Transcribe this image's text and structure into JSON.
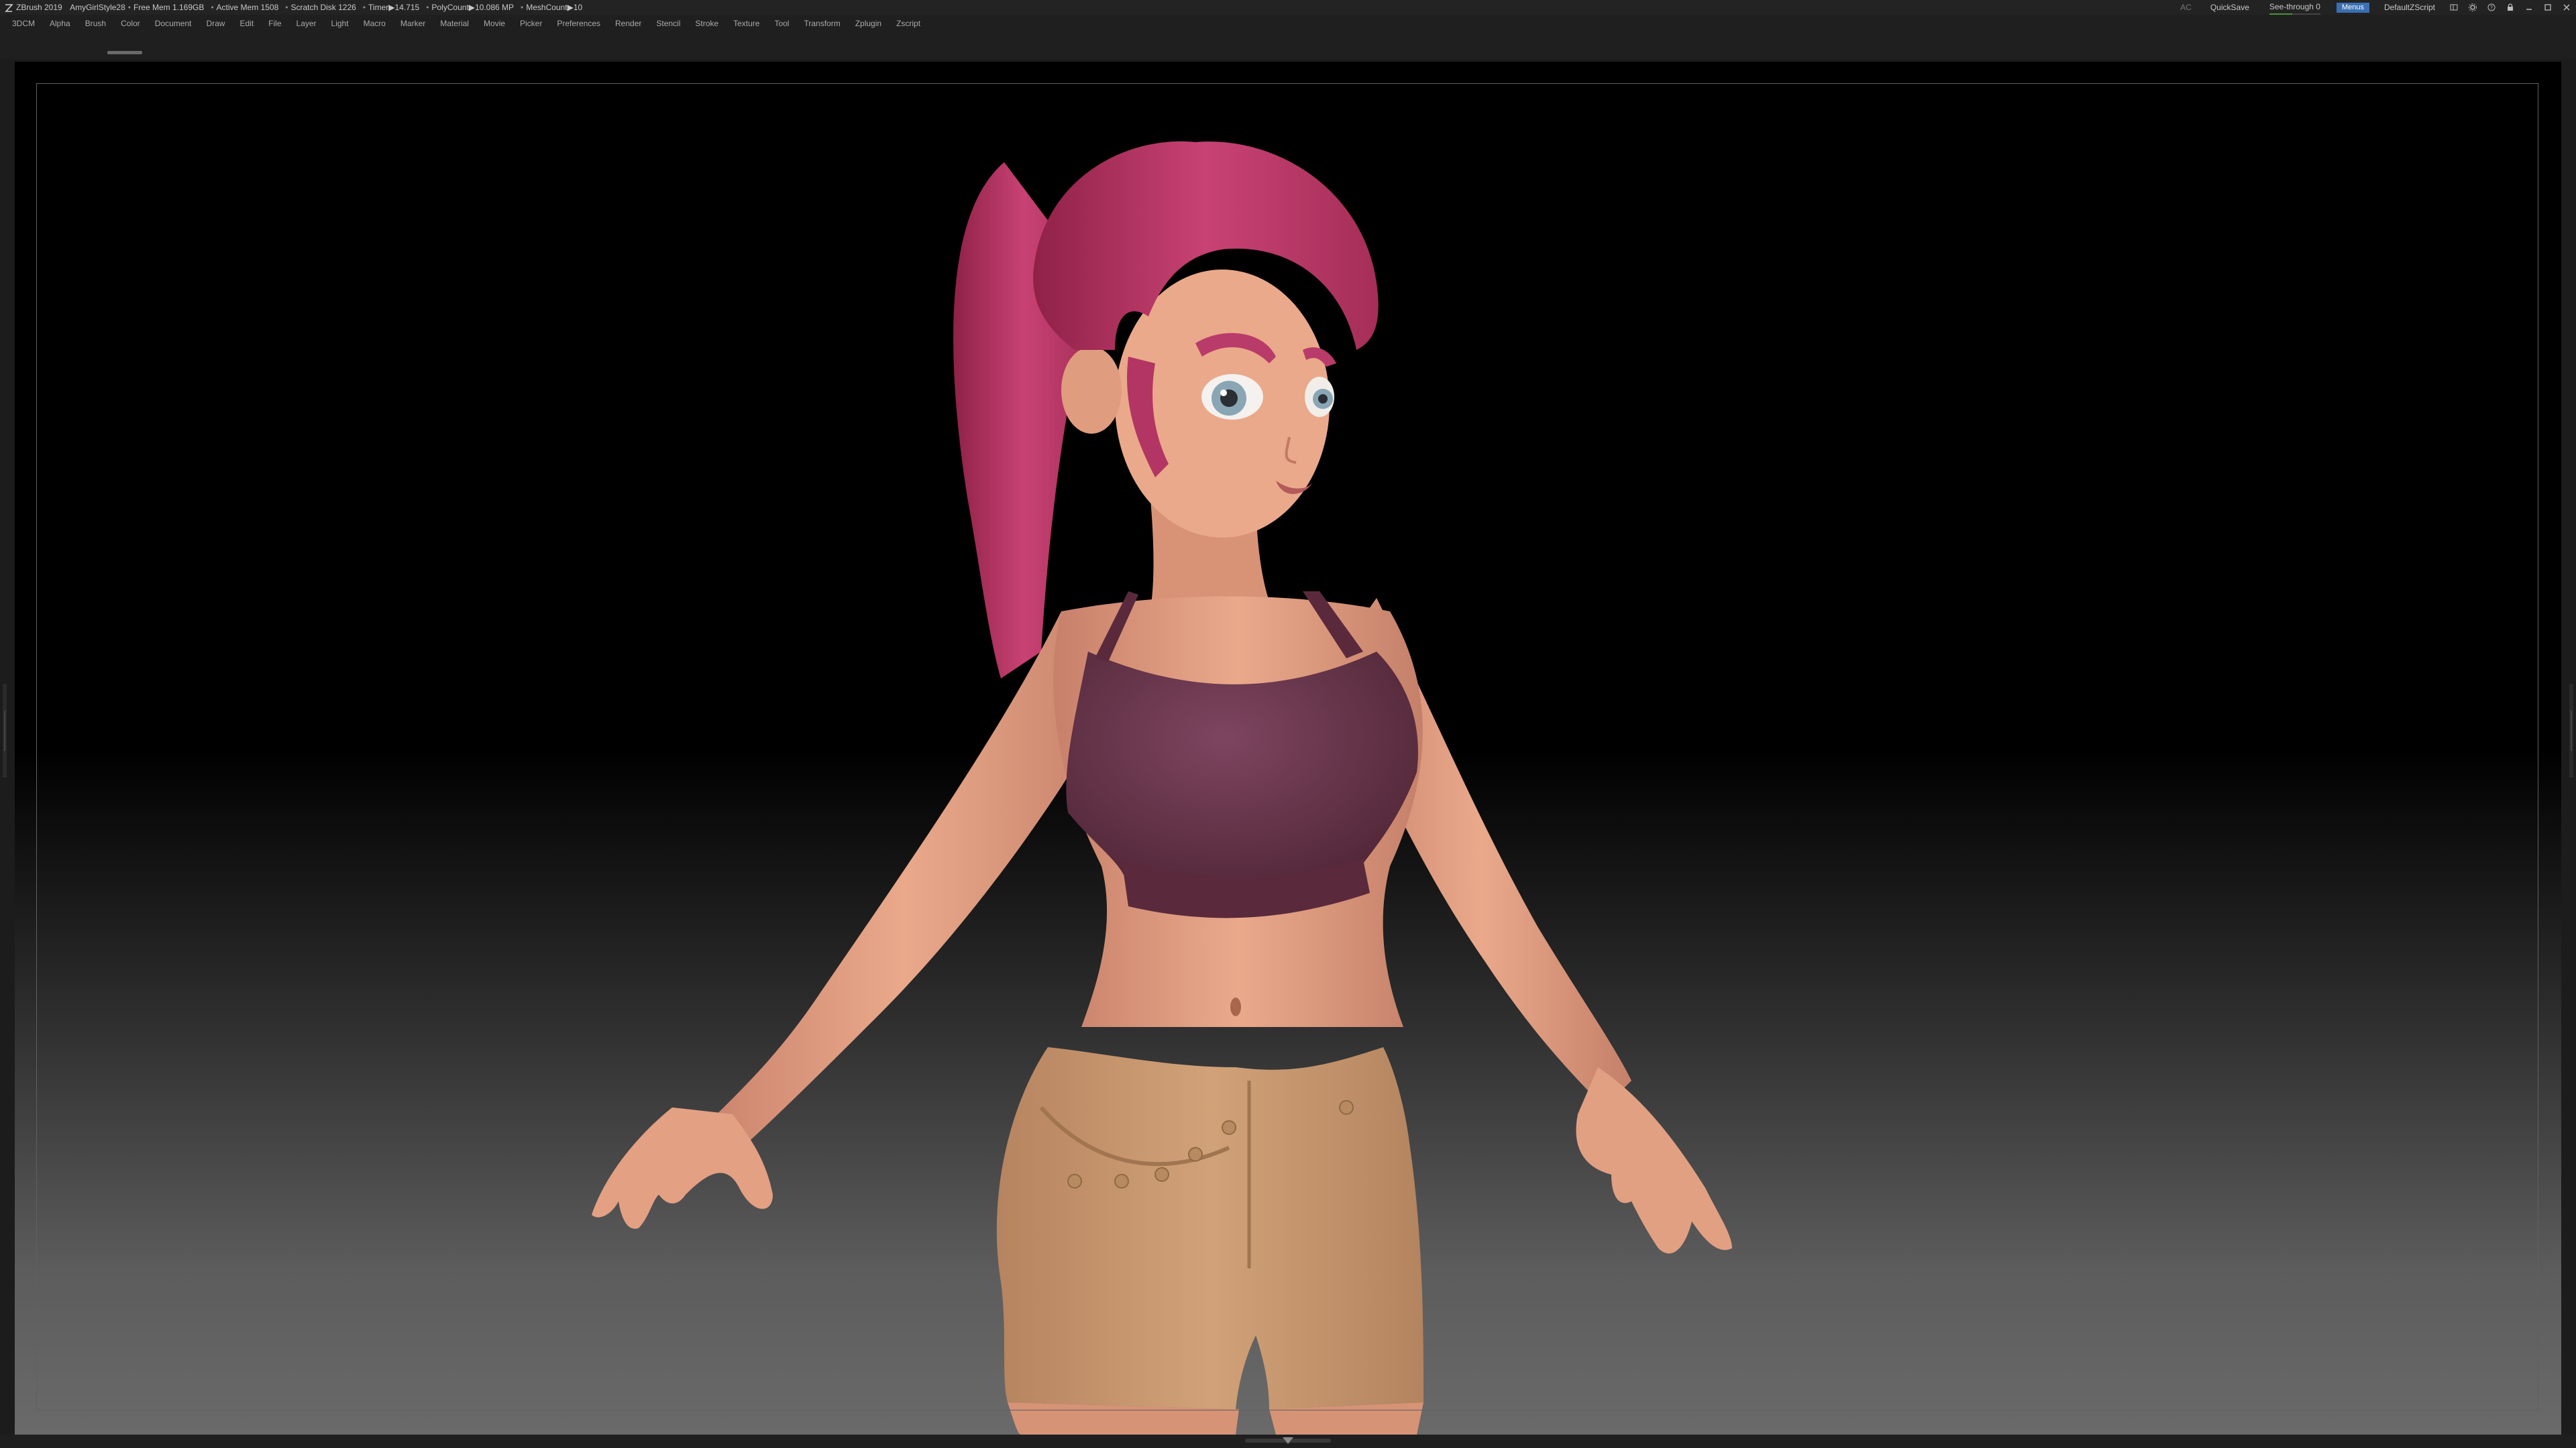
{
  "titlebar": {
    "app": "ZBrush 2019",
    "project": "AmyGirlStyle28",
    "free_mem": "Free Mem 1.169GB",
    "active_mem": "Active Mem 1508",
    "scratch_disk": "Scratch Disk 1226",
    "timer": "Timer▶14.715",
    "poly_count": "PolyCount▶10.086 MP",
    "mesh_count": "MeshCount▶10",
    "ac_label": "AC",
    "quicksave_label": "QuickSave",
    "see_through_label": "See-through 0",
    "see_through_value": 0,
    "menus_label": "Menus",
    "script_label": "DefaultZScript"
  },
  "menus": [
    "3DCM",
    "Alpha",
    "Brush",
    "Color",
    "Document",
    "Draw",
    "Edit",
    "File",
    "Layer",
    "Light",
    "Macro",
    "Marker",
    "Material",
    "Movie",
    "Picker",
    "Preferences",
    "Render",
    "Stencil",
    "Stroke",
    "Texture",
    "Tool",
    "Transform",
    "Zplugin",
    "Zscript"
  ],
  "colors": {
    "accent": "#3a6fb2",
    "skin": "#e7a584",
    "hair": "#c23f6c",
    "top": "#6b3448",
    "shorts": "#c9996c"
  }
}
